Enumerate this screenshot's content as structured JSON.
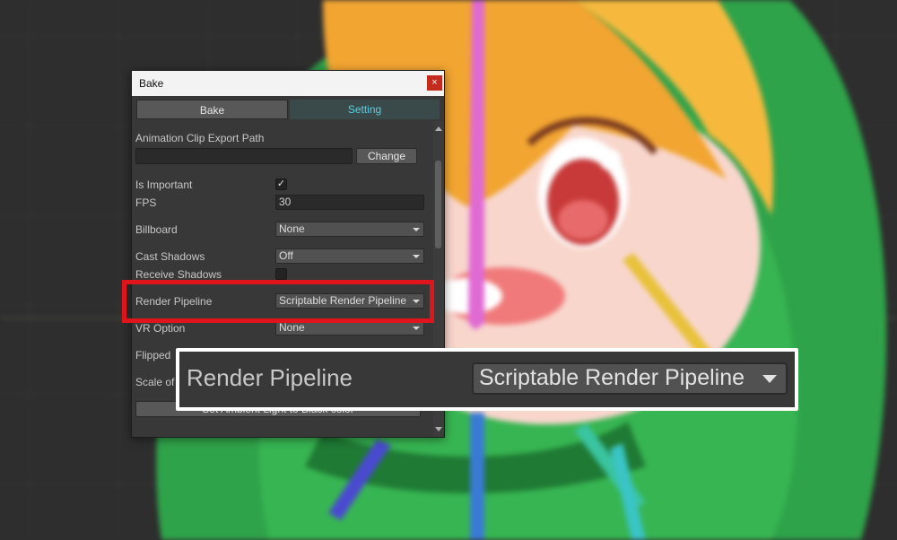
{
  "window": {
    "title": "Bake",
    "close_glyph": "×",
    "tabs": [
      {
        "label": "Bake",
        "active": false
      },
      {
        "label": "Setting",
        "active": true
      }
    ]
  },
  "settings": {
    "export_path_label": "Animation Clip Export Path",
    "export_path_value": "",
    "change_button": "Change",
    "is_important": {
      "label": "Is Important",
      "checked": true,
      "glyph": "✓"
    },
    "fps": {
      "label": "FPS",
      "value": "30"
    },
    "billboard": {
      "label": "Billboard",
      "value": "None"
    },
    "cast_shadows": {
      "label": "Cast Shadows",
      "value": "Off"
    },
    "receive_shadows": {
      "label": "Receive Shadows",
      "checked": false
    },
    "render_pipeline": {
      "label": "Render Pipeline",
      "value": "Scriptable Render Pipeline"
    },
    "vr_option": {
      "label": "VR Option",
      "value": "None"
    },
    "flipped_label": "Flipped",
    "scale_label": "Scale of",
    "ambient_button": "Set Ambient Light to Black color"
  },
  "callout": {
    "label": "Render Pipeline",
    "value": "Scriptable Render Pipeline"
  },
  "colors": {
    "highlight": "#e0141b",
    "active_tab_text": "#56d0e6",
    "character_green": "#2fa34a",
    "character_hair": "#f2a531"
  }
}
